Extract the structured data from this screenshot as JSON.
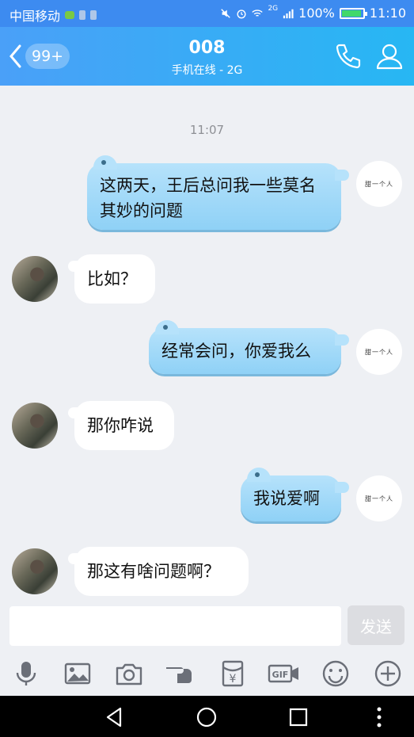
{
  "status_bar": {
    "carrier": "中国移动",
    "network": "2G",
    "battery": "100%",
    "battery_level": 1.0,
    "time": "11:10"
  },
  "header": {
    "back_badge": "99+",
    "title": "008",
    "subtitle": "手机在线 - 2G"
  },
  "chat": {
    "timestamp": "11:07",
    "my_avatar_text": "甜一个人",
    "messages": [
      {
        "side": "right",
        "text": "这两天，王后总问我一些莫名其妙的问题"
      },
      {
        "side": "left",
        "text": "比如？"
      },
      {
        "side": "right",
        "text": "经常会问，你爱我么"
      },
      {
        "side": "left",
        "text": "那你咋说"
      },
      {
        "side": "right",
        "text": "我说爱啊"
      },
      {
        "side": "left",
        "text": "那这有啥问题啊？"
      }
    ]
  },
  "composer": {
    "placeholder": "",
    "send_label": "发送"
  },
  "toolbar": {
    "gif_label": "GIF",
    "red_packet_symbol": "¥",
    "icons": [
      "microphone-icon",
      "image-icon",
      "camera-icon",
      "poke-icon",
      "red-packet-icon",
      "gif-icon",
      "emoji-icon",
      "plus-icon"
    ]
  },
  "colors": {
    "header_start": "#4aa0f8",
    "header_end": "#27b7f3",
    "bubble_mine": "#9fd8f8",
    "bubble_other": "#ffffff",
    "background": "#eef0f4"
  }
}
